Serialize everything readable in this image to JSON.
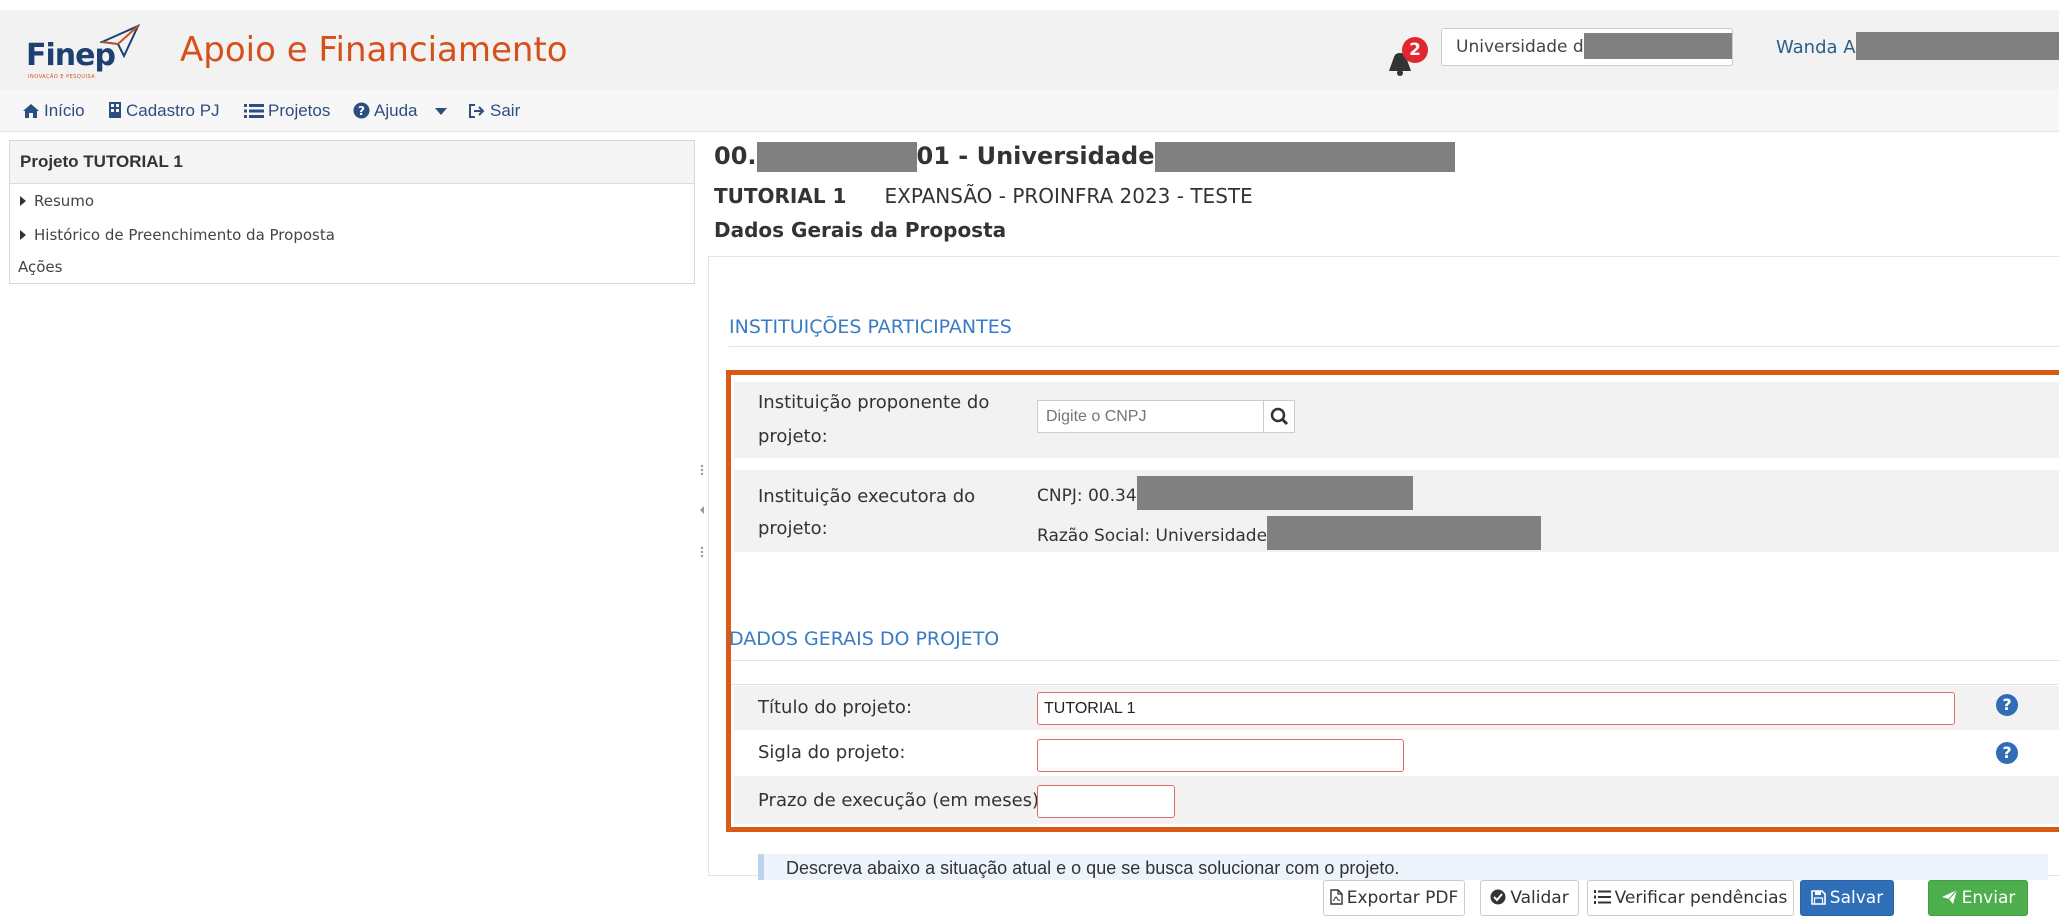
{
  "header": {
    "logo_text": "Finep",
    "logo_sub": "INOVAÇÃO E PESQUISA",
    "app_title": "Apoio e Financiamento",
    "notification_count": "2",
    "institution_value": "Universidade d",
    "user_name": "Wanda A"
  },
  "nav": {
    "items": [
      {
        "label": "Início",
        "icon": "home-icon"
      },
      {
        "label": "Cadastro PJ",
        "icon": "building-icon"
      },
      {
        "label": "Projetos",
        "icon": "list-icon"
      },
      {
        "label": "Ajuda",
        "icon": "question-circle-icon"
      },
      {
        "label": "Sair",
        "icon": "sign-out-icon"
      }
    ]
  },
  "sidebar": {
    "title": "Projeto TUTORIAL 1",
    "items": [
      {
        "label": "Resumo"
      },
      {
        "label": "Histórico de Preenchimento da Proposta"
      }
    ],
    "actions_label": "Ações"
  },
  "main": {
    "title_prefix": "00.",
    "title_mid": "01 - Universidade",
    "sub_code": "TUTORIAL 1",
    "sub_program": "EXPANSÃO - PROINFRA 2023 - TESTE",
    "section_title": "Dados Gerais da Proposta"
  },
  "institutions": {
    "heading": "INSTITUIÇÕES PARTICIPANTES",
    "proponente_label_1": "Instituição proponente do",
    "proponente_label_2": "projeto:",
    "cnpj_placeholder": "Digite o CNPJ",
    "executora_label_1": "Instituição executora do",
    "executora_label_2": "projeto:",
    "cnpj_text": "CNPJ: 00.34",
    "razao_text": "Razão Social: Universidade"
  },
  "project": {
    "heading": "DADOS GERAIS DO PROJETO",
    "titulo_label": "Título do projeto:",
    "titulo_value": "TUTORIAL 1",
    "sigla_label": "Sigla do projeto:",
    "sigla_value": "",
    "prazo_label": "Prazo de execução (em meses):",
    "prazo_value": ""
  },
  "description": "Descreva abaixo a situação atual e o que se busca solucionar com o projeto.",
  "buttons": {
    "export_pdf": "Exportar PDF",
    "validar": "Validar",
    "verificar": "Verificar pendências",
    "salvar": "Salvar",
    "enviar": "Enviar"
  },
  "colors": {
    "brand_orange": "#d6501c",
    "brand_navy": "#1d3f72",
    "link_blue": "#2c4e80",
    "section_blue": "#3a7cc4",
    "highlight": "#d85a14",
    "save_blue": "#2e6fb7",
    "send_green": "#4cae4c"
  }
}
